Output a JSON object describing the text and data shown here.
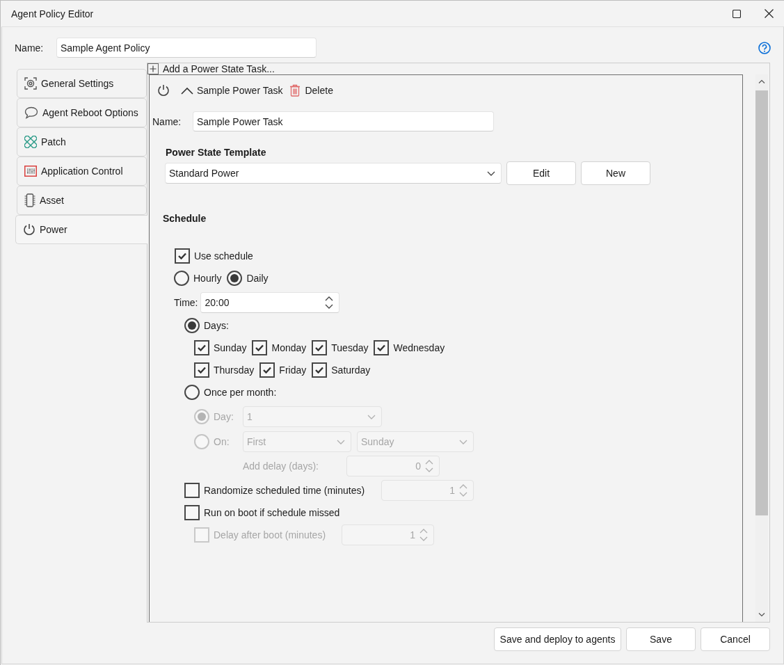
{
  "window": {
    "title": "Agent Policy Editor"
  },
  "policy_name": {
    "label": "Name:",
    "value": "Sample Agent Policy"
  },
  "tabs": [
    {
      "label": "General Settings",
      "selected": false
    },
    {
      "label": "Agent Reboot Options",
      "selected": false
    },
    {
      "label": "Patch",
      "selected": false
    },
    {
      "label": "Application Control",
      "selected": false
    },
    {
      "label": "Asset",
      "selected": false
    },
    {
      "label": "Power",
      "selected": true
    }
  ],
  "add_task": {
    "label": "Add a Power State Task..."
  },
  "task": {
    "title": "Sample Power Task",
    "expanded": true,
    "delete_label": "Delete",
    "name_label": "Name:",
    "name_value": "Sample Power Task",
    "template": {
      "heading": "Power State Template",
      "value": "Standard Power",
      "buttons": [
        "Edit",
        "New"
      ]
    },
    "schedule": {
      "heading": "Schedule",
      "use_schedule": {
        "label": "Use schedule",
        "checked": true
      },
      "frequency": [
        {
          "label": "Hourly",
          "selected": false
        },
        {
          "label": "Daily",
          "selected": true
        }
      ],
      "time": {
        "label": "Time:",
        "value": "20:00"
      },
      "days_option": {
        "label": "Days:",
        "selected": true
      },
      "day_rows": [
        [
          {
            "label": "Sunday",
            "checked": true
          },
          {
            "label": "Monday",
            "checked": true
          },
          {
            "label": "Tuesday",
            "checked": true
          },
          {
            "label": "Wednesday",
            "checked": true
          }
        ],
        [
          {
            "label": "Thursday",
            "checked": true
          },
          {
            "label": "Friday",
            "checked": true
          },
          {
            "label": "Saturday",
            "checked": true
          }
        ]
      ],
      "monthly_option": {
        "label": "Once per month:",
        "selected": false
      },
      "day_option": {
        "label": "Day:",
        "selected": true,
        "disabled": true,
        "value": "1"
      },
      "on_option": {
        "label": "On:",
        "selected": false,
        "disabled": true,
        "values": [
          "First",
          "Sunday"
        ]
      },
      "add_delay": {
        "label": "Add delay (days):",
        "value": "0",
        "disabled": true
      },
      "randomize": {
        "label": "Randomize scheduled time (minutes)",
        "checked": false,
        "value": "1",
        "disabled": true
      },
      "run_on_boot": {
        "label": "Run on boot if schedule missed",
        "checked": false
      },
      "delay_after_boot": {
        "label": "Delay after boot (minutes)",
        "checked": false,
        "disabled": true,
        "value": "1"
      }
    }
  },
  "buttons": [
    {
      "label": "Save and deploy to agents"
    },
    {
      "label": "Save"
    },
    {
      "label": "Cancel"
    }
  ]
}
